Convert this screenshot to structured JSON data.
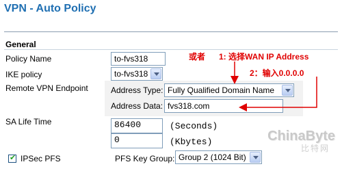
{
  "page": {
    "title": "VPN - Auto Policy"
  },
  "general": {
    "section_title": "General",
    "policy_name_label": "Policy Name",
    "policy_name_value": "to-fvs318",
    "ike_policy_label": "IKE policy",
    "ike_policy_value": "to-fvs318",
    "remote_endpoint_label": "Remote VPN Endpoint",
    "address_type_label": "Address Type:",
    "address_type_value": "Fully Qualified Domain Name",
    "address_data_label": "Address Data:",
    "address_data_value": "fvs318.com",
    "sa_lifetime_label": "SA Life Time",
    "sa_seconds_value": "86400",
    "sa_seconds_unit": "(Seconds)",
    "sa_kbytes_value": "0",
    "sa_kbytes_unit": "(Kbytes)",
    "ipsec_pfs_label": "IPSec PFS",
    "ipsec_pfs_checked": true,
    "pfs_key_group_label": "PFS Key Group:",
    "pfs_key_group_value": "Group 2 (1024 Bit)"
  },
  "annotations": {
    "or": "或者",
    "step1": "1: 选择WAN IP Address",
    "step2": "2：输入0.0.0.0",
    "color": "#e00000"
  },
  "watermark": {
    "brand": "ChinaByte",
    "sub": "比特网"
  }
}
